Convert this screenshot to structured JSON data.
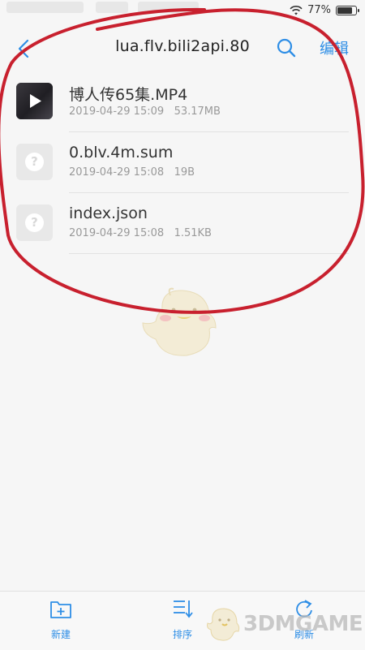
{
  "status_bar": {
    "battery_text": "77%",
    "battery_level": 0.77
  },
  "top_bar": {
    "title": "lua.flv.bili2api.80",
    "edit_label": "编辑"
  },
  "files": [
    {
      "name": "博人传65集.MP4",
      "date": "2019-04-29 15:09",
      "size": "53.17MB",
      "icon": "video-thumbnail"
    },
    {
      "name": "0.blv.4m.sum",
      "date": "2019-04-29 15:08",
      "size": "19B",
      "icon": "unknown-file-icon"
    },
    {
      "name": "index.json",
      "date": "2019-04-29 15:08",
      "size": "1.51KB",
      "icon": "unknown-file-icon"
    }
  ],
  "bottom_bar": {
    "new_label": "新建",
    "sort_label": "排序",
    "refresh_label": "刷新"
  },
  "watermark": {
    "text": "3DMGAME"
  },
  "colors": {
    "accent": "#2e8ee6",
    "annotation": "#c8202e",
    "background": "#f6f6f6"
  }
}
